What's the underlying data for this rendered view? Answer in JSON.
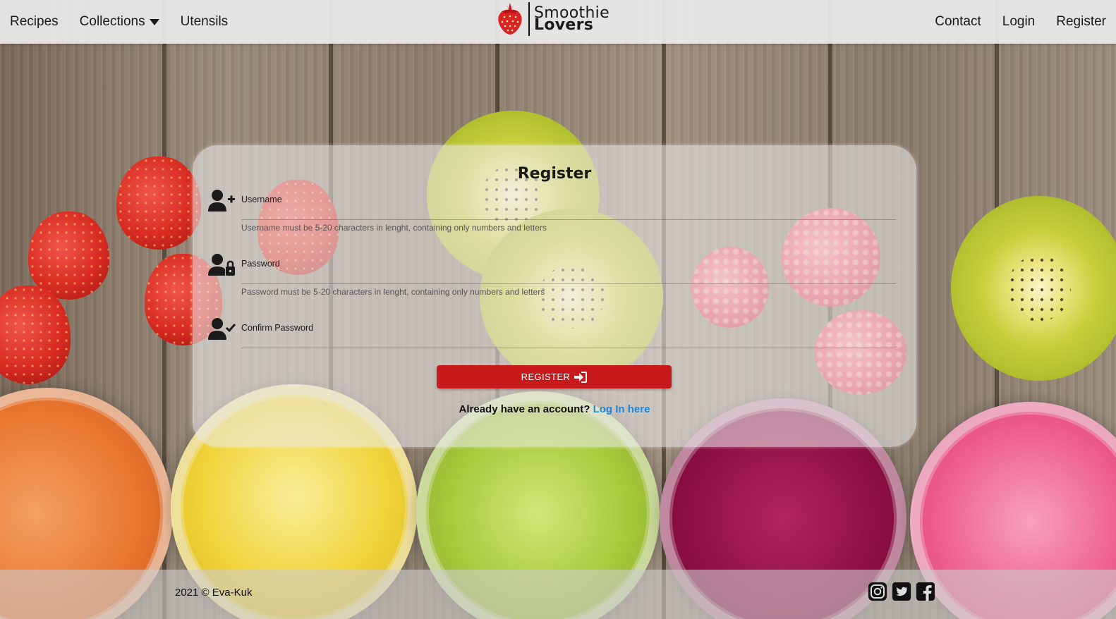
{
  "nav": {
    "left": [
      {
        "label": "Recipes"
      },
      {
        "label": "Collections"
      },
      {
        "label": "Utensils"
      }
    ],
    "right": [
      {
        "label": "Contact"
      },
      {
        "label": "Login"
      },
      {
        "label": "Register"
      }
    ],
    "brand": {
      "line1": "Smoothie",
      "line2": "Lovers"
    }
  },
  "form": {
    "title": "Register",
    "username": {
      "label": "Username",
      "value": "",
      "help": "Username must be 5-20 characters in lenght, containing only numbers and letters",
      "icon": "user-plus-icon"
    },
    "password": {
      "label": "Password",
      "value": "",
      "help": "Password must be 5-20 characters in lenght, containing only numbers and letters",
      "icon": "user-lock-icon"
    },
    "confirm": {
      "label": "Confirm Password",
      "value": "",
      "icon": "user-check-icon"
    },
    "submit_label": "REGISTER",
    "submit_icon": "sign-in-icon",
    "login_prompt": "Already have an account?",
    "login_link": "Log In here"
  },
  "footer": {
    "copyright": "2021 © Eva-Kuk",
    "social": [
      "instagram-icon",
      "twitter-icon",
      "facebook-icon"
    ]
  },
  "colors": {
    "accent": "#c8191b",
    "link": "#1e88d8"
  }
}
